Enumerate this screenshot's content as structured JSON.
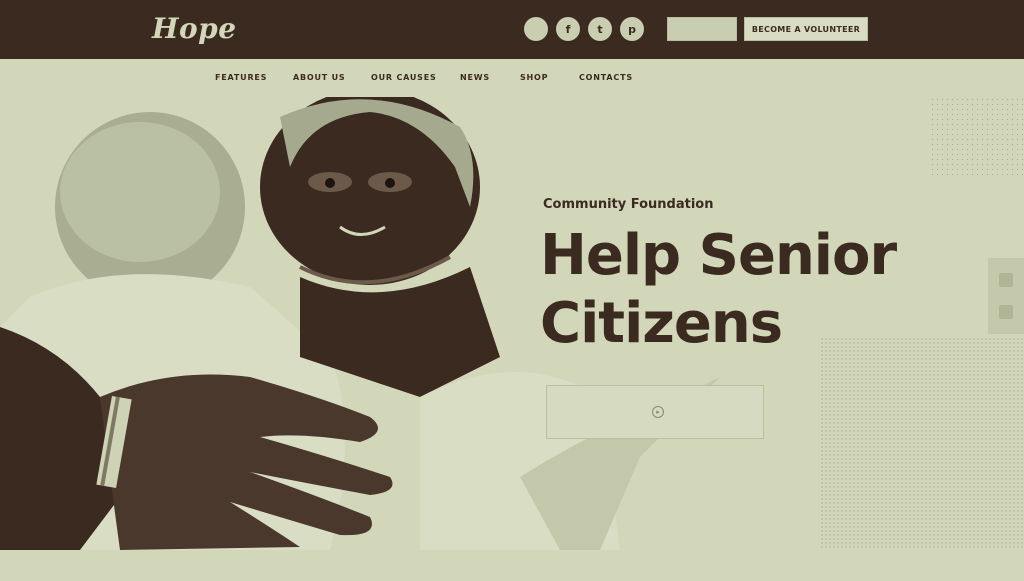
{
  "header": {
    "logo": "Hope",
    "socials": [
      {
        "icon": "globe-icon",
        "glyph": ""
      },
      {
        "icon": "facebook-icon",
        "glyph": "f"
      },
      {
        "icon": "twitter-icon",
        "glyph": "t"
      },
      {
        "icon": "pinterest-icon",
        "glyph": "p"
      }
    ],
    "donate_label": "",
    "volunteer_label": "BECOME A VOLUNTEER"
  },
  "nav": {
    "items": [
      "FEATURES",
      "ABOUT US",
      "OUR CAUSES",
      "NEWS",
      "SHOP",
      "CONTACTS"
    ]
  },
  "hero": {
    "eyebrow": "Community Foundation",
    "headline_line1": "Help Senior",
    "headline_line2": "Citizens",
    "cta_label": "",
    "cta_icon": "arrow-right-icon"
  },
  "colors": {
    "dark": "#3b2a20",
    "light": "#d2d7b9"
  }
}
